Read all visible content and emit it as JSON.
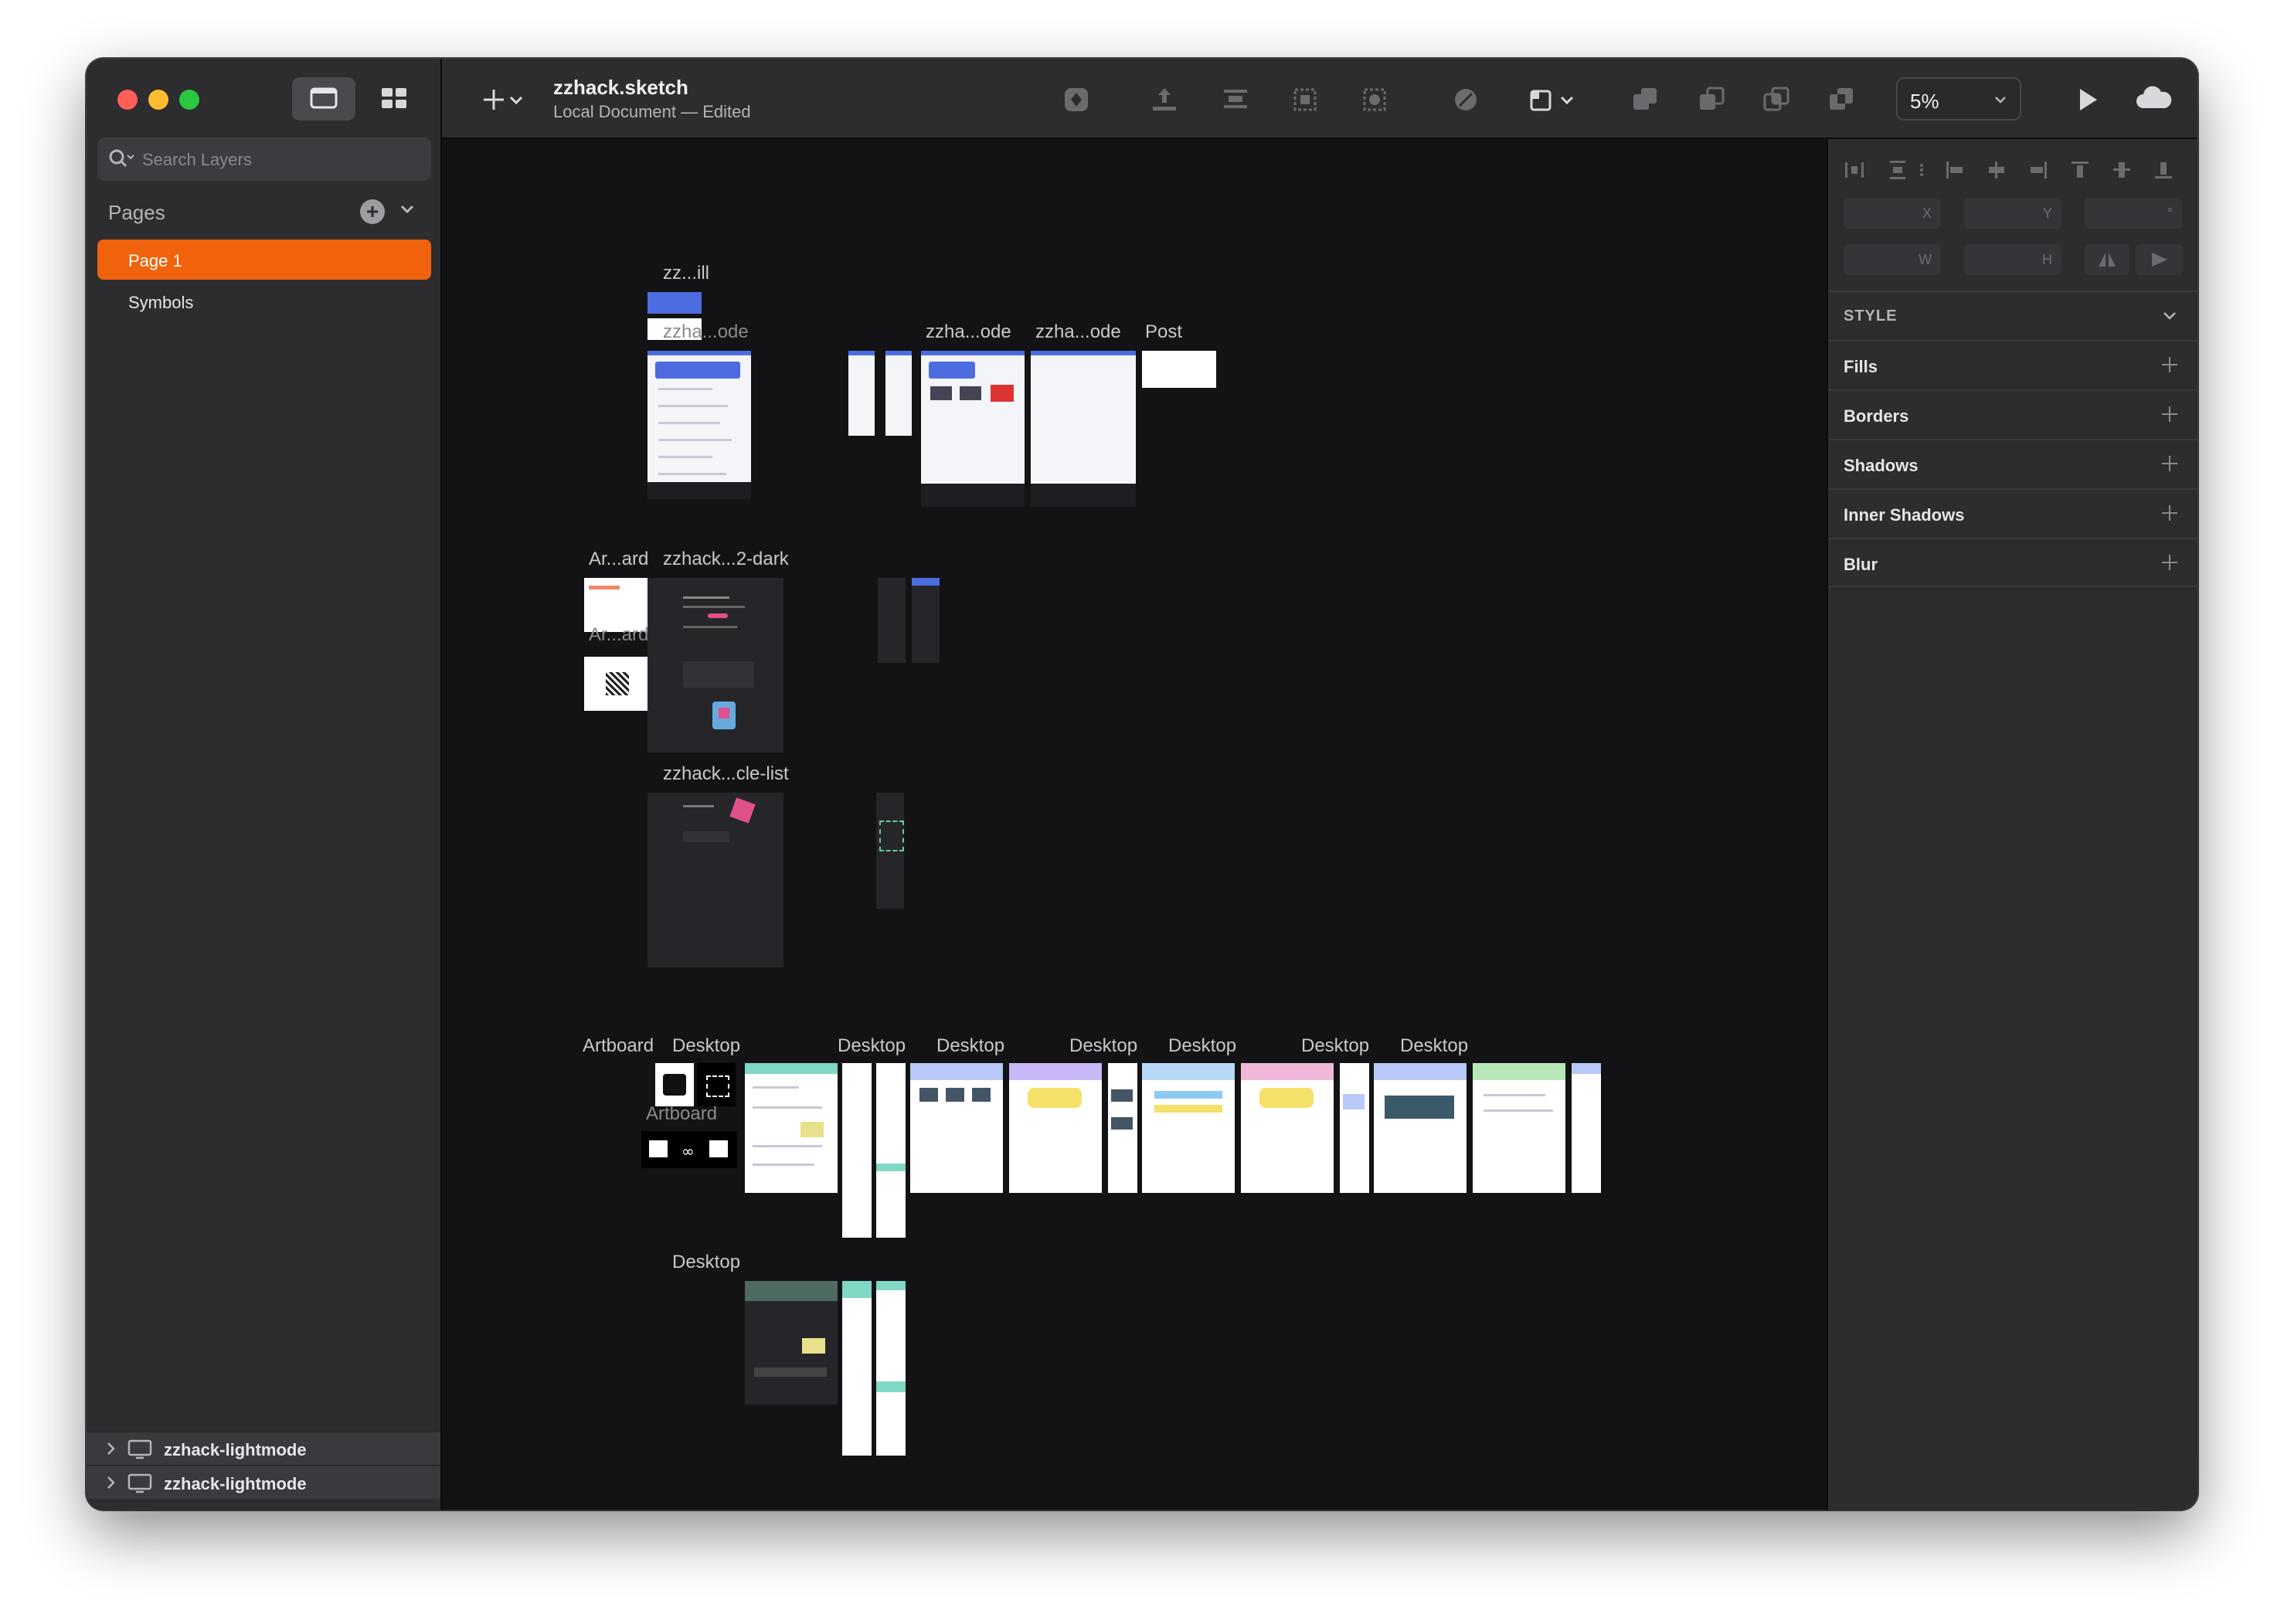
{
  "document": {
    "title": "zzhack.sketch",
    "subtitle": "Local Document — Edited",
    "zoom": "5%"
  },
  "sidebar": {
    "search_placeholder": "Search Layers",
    "pages_label": "Pages",
    "pages": [
      "Page 1",
      "Symbols"
    ],
    "layers": [
      "zzhack-lightmode",
      "zzhack-lightmode"
    ]
  },
  "canvas": {
    "labels": {
      "zz_ill": "zz...ill",
      "zzha_ode_1": "zzha...ode",
      "zzha_ode_2": "zzha...ode",
      "zzha_ode_3": "zzha...ode",
      "post": "Post",
      "ar_ard_1": "Ar...ard",
      "ar_ard_2": "Ar...ard",
      "zzhack_2_dark": "zzhack...2-dark",
      "zzhack_cle_list": "zzhack...cle-list",
      "artboard_1": "Artboard",
      "artboard_2": "Artboard",
      "desktop_1": "Desktop",
      "desktop_2": "Desktop",
      "desktop_3": "Desktop",
      "desktop_4": "Desktop",
      "desktop_5": "Desktop",
      "desktop_6": "Desktop",
      "desktop_7": "Desktop",
      "desktop_8": "Desktop"
    }
  },
  "inspector": {
    "fields": [
      "X",
      "Y",
      "°",
      "W",
      "H"
    ],
    "style_label": "STYLE",
    "sections": [
      "Fills",
      "Borders",
      "Shadows",
      "Inner Shadows",
      "Blur"
    ]
  },
  "colors": {
    "accent": "#f0630c",
    "sidebar_bg": "#2d2c2f",
    "canvas_bg": "#131315",
    "artboard_blue": "#4c6ce0"
  }
}
